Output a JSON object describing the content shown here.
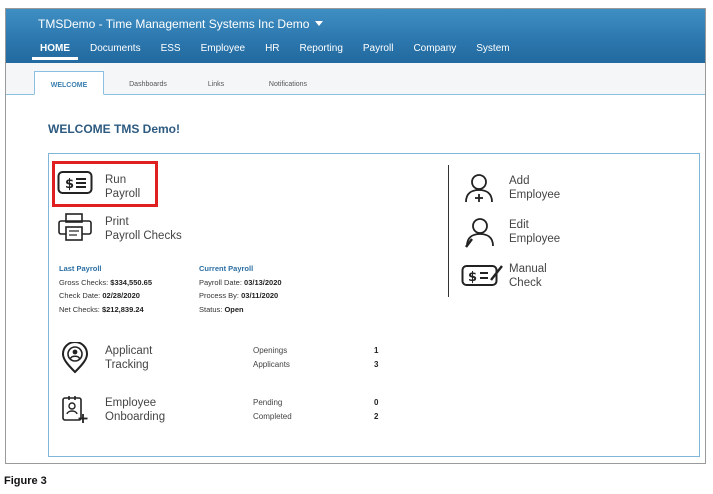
{
  "header": {
    "app_title": "TMSDemo - Time Management Systems Inc Demo",
    "nav": [
      "HOME",
      "Documents",
      "ESS",
      "Employee",
      "HR",
      "Reporting",
      "Payroll",
      "Company",
      "System"
    ]
  },
  "subtabs": [
    "WELCOME",
    "Dashboards",
    "Links",
    "Notifications"
  ],
  "welcome_title": "WELCOME TMS Demo!",
  "actions": {
    "run_payroll": [
      "Run",
      "Payroll"
    ],
    "print_checks": [
      "Print",
      "Payroll Checks"
    ],
    "add_employee": [
      "Add",
      "Employee"
    ],
    "edit_employee": [
      "Edit",
      "Employee"
    ],
    "manual_check": [
      "Manual",
      "Check"
    ],
    "applicant_tracking": [
      "Applicant",
      "Tracking"
    ],
    "employee_onboarding": [
      "Employee",
      "Onboarding"
    ]
  },
  "last_payroll": {
    "heading": "Last Payroll",
    "gross_label": "Gross Checks:",
    "gross_value": "$334,550.65",
    "check_date_label": "Check Date:",
    "check_date_value": "02/28/2020",
    "net_label": "Net Checks:",
    "net_value": "$212,839.24"
  },
  "current_payroll": {
    "heading": "Current Payroll",
    "payroll_date_label": "Payroll Date:",
    "payroll_date_value": "03/13/2020",
    "process_by_label": "Process By:",
    "process_by_value": "03/11/2020",
    "status_label": "Status:",
    "status_value": "Open"
  },
  "applicant_metrics": [
    {
      "label": "Openings",
      "value": "1"
    },
    {
      "label": "Applicants",
      "value": "3"
    }
  ],
  "onboarding_metrics": [
    {
      "label": "Pending",
      "value": "0"
    },
    {
      "label": "Completed",
      "value": "2"
    }
  ],
  "caption": "Figure 3",
  "colors": {
    "header": "#2b76ad",
    "highlight": "#e02020",
    "accent": "#2b6ea3"
  }
}
